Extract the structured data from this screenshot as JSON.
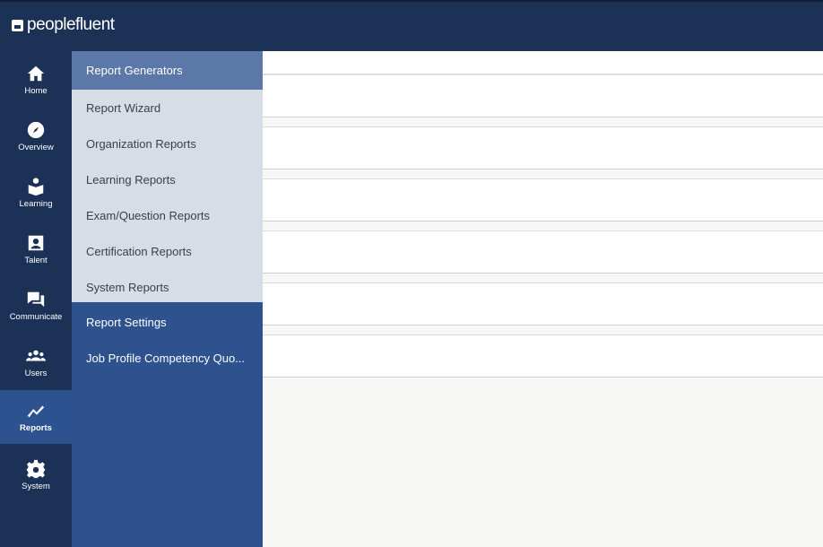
{
  "brand": {
    "logo_text": "peoplefluent"
  },
  "leftnav": {
    "items": [
      {
        "label": "Home",
        "icon": "home-icon"
      },
      {
        "label": "Overview",
        "icon": "compass-icon"
      },
      {
        "label": "Learning",
        "icon": "learning-icon"
      },
      {
        "label": "Talent",
        "icon": "talent-icon"
      },
      {
        "label": "Communicate",
        "icon": "chat-icon"
      },
      {
        "label": "Users",
        "icon": "users-icon"
      },
      {
        "label": "Reports",
        "icon": "chart-icon",
        "active": true
      },
      {
        "label": "System",
        "icon": "gear-icon"
      }
    ]
  },
  "submenu": {
    "header": "Report Generators",
    "children": [
      "Report Wizard",
      "Organization Reports",
      "Learning Reports",
      "Exam/Question Reports",
      "Certification Reports",
      "System Reports"
    ],
    "items": [
      "Report Settings",
      "Job Profile Competency Quo..."
    ]
  },
  "colors": {
    "topbar": "#1c3156",
    "nav_active": "#2d5290",
    "submenu_bg": "#2d528e",
    "submenu_header": "#5c78a8",
    "submenu_group": "#d7dce6"
  }
}
